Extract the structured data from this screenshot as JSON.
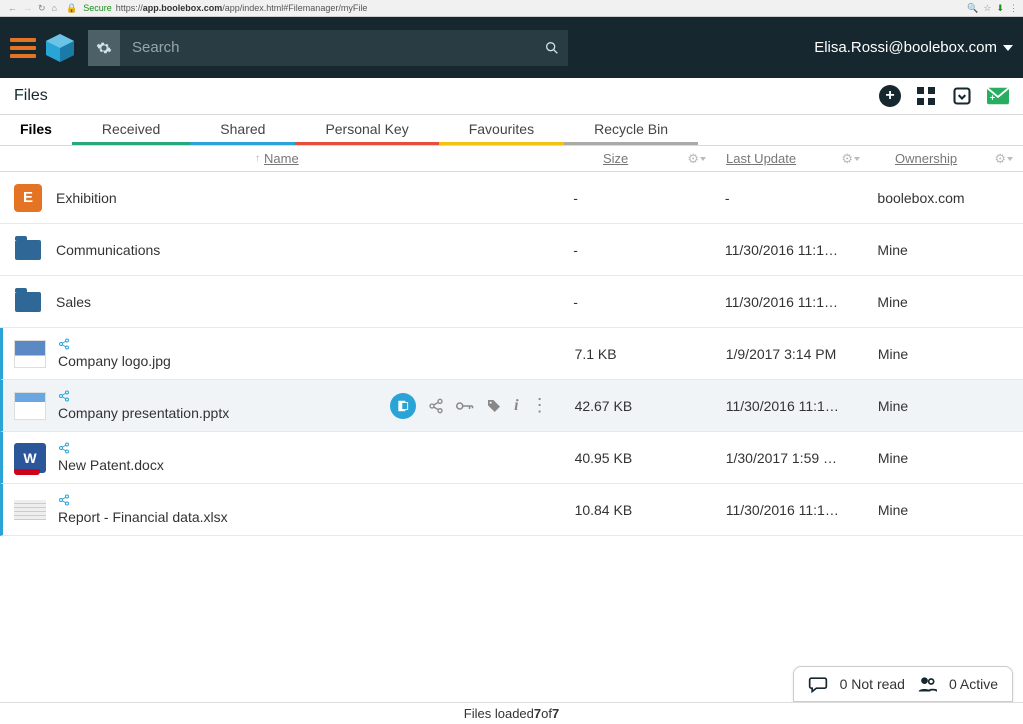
{
  "browser": {
    "secure_label": "Secure",
    "url_host": "app.boolebox.com",
    "url_scheme": "https://",
    "url_path": "/app/index.html#Filemanager/myFile"
  },
  "header": {
    "search_placeholder": "Search",
    "user_email": "Elisa.Rossi@boolebox.com"
  },
  "section": {
    "title": "Files"
  },
  "tabs": [
    {
      "label": "Files",
      "active": true
    },
    {
      "label": "Received",
      "active": false
    },
    {
      "label": "Shared",
      "active": false
    },
    {
      "label": "Personal Key",
      "active": false
    },
    {
      "label": "Favourites",
      "active": false
    },
    {
      "label": "Recycle Bin",
      "active": false
    }
  ],
  "columns": {
    "name": "Name",
    "size": "Size",
    "last": "Last Update",
    "own": "Ownership"
  },
  "rows": [
    {
      "name": "Exhibition",
      "size": "-",
      "last": "-",
      "own": "boolebox.com"
    },
    {
      "name": "Communications",
      "size": "-",
      "last": "11/30/2016 11:1…",
      "own": "Mine"
    },
    {
      "name": "Sales",
      "size": "-",
      "last": "11/30/2016 11:1…",
      "own": "Mine"
    },
    {
      "name": "Company logo.jpg",
      "size": "7.1 KB",
      "last": "1/9/2017 3:14 PM",
      "own": "Mine"
    },
    {
      "name": "Company presentation.pptx",
      "size": "42.67 KB",
      "last": "11/30/2016 11:1…",
      "own": "Mine"
    },
    {
      "name": "New Patent.docx",
      "size": "40.95 KB",
      "last": "1/30/2017 1:59 …",
      "own": "Mine"
    },
    {
      "name": "Report - Financial data.xlsx",
      "size": "10.84 KB",
      "last": "11/30/2016 11:1…",
      "own": "Mine"
    }
  ],
  "status": {
    "not_read": "0 Not read",
    "active": "0 Active"
  },
  "footer": {
    "prefix": "Files loaded ",
    "loaded": "7",
    "of": " of ",
    "total": "7"
  }
}
